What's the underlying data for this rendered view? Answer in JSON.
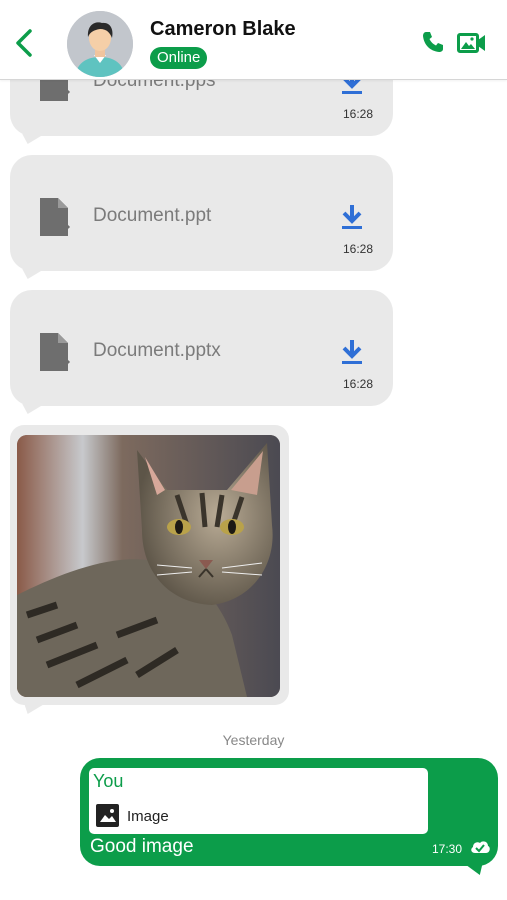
{
  "header": {
    "contact_name": "Cameron Blake",
    "status": "Online",
    "icons": {
      "back": "chevron-left-icon",
      "call": "phone-icon",
      "video": "video-call-icon"
    },
    "accent_color": "#0c9d4a"
  },
  "messages": [
    {
      "type": "document",
      "file_name": "Document.pps",
      "time": "16:28"
    },
    {
      "type": "document",
      "file_name": "Document.ppt",
      "time": "16:28"
    },
    {
      "type": "document",
      "file_name": "Document.pptx",
      "time": "16:28"
    },
    {
      "type": "image",
      "content": "photo of a tabby cat"
    }
  ],
  "date_separator": "Yesterday",
  "outgoing": {
    "reply_author": "You",
    "reply_preview": "Image",
    "text": "Good image",
    "time": "17:30",
    "bubble_color": "#0c9d4a"
  }
}
